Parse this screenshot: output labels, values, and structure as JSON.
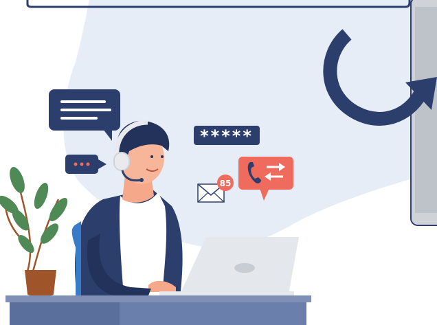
{
  "scene": {
    "password_mask": "*****",
    "notification_count": "85"
  },
  "icons": {
    "chat": "chat-bubble-icon",
    "typing": "typing-bubble-icon",
    "password": "password-field-icon",
    "mail": "envelope-icon",
    "call_transfer": "phone-transfer-icon",
    "refresh_arrow": "circular-arrow-icon"
  },
  "colors": {
    "navy": "#2c3e6b",
    "navy_dark": "#22325a",
    "coral": "#ef6b5e",
    "background_blob": "#e6edf6",
    "plant_green": "#4f8a56",
    "pot_brown": "#a0542a",
    "desk_blue": "#5a6f9c"
  }
}
